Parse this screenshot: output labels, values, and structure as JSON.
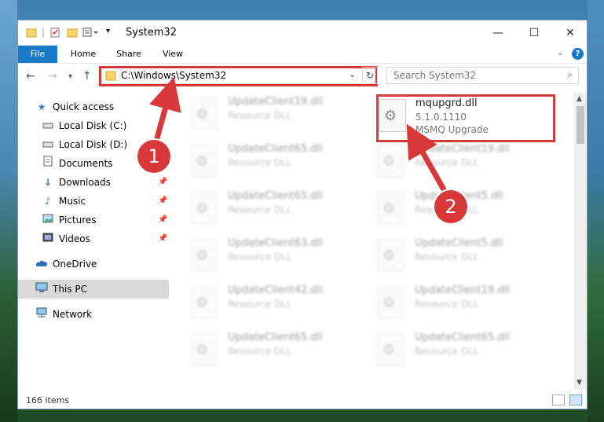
{
  "window": {
    "title": "System32"
  },
  "controls": {
    "minimize": "—",
    "maximize": "☐",
    "close": "✕"
  },
  "ribbon": {
    "tabs": [
      "File",
      "Home",
      "Share",
      "View"
    ],
    "help": "?"
  },
  "navigation": {
    "address": "C:\\Windows\\System32",
    "search_placeholder": "Search System32"
  },
  "sidebar": {
    "items": [
      {
        "label": "Quick access",
        "icon": "star-icon"
      },
      {
        "label": "Local Disk (C:)",
        "icon": "drive-icon"
      },
      {
        "label": "Local Disk (D:)",
        "icon": "drive-icon"
      },
      {
        "label": "Documents",
        "icon": "documents-icon"
      },
      {
        "label": "Downloads",
        "icon": "download-icon"
      },
      {
        "label": "Music",
        "icon": "music-icon"
      },
      {
        "label": "Pictures",
        "icon": "pictures-icon"
      },
      {
        "label": "Videos",
        "icon": "videos-icon"
      },
      {
        "label": "OneDrive",
        "icon": "cloud-icon"
      },
      {
        "label": "This PC",
        "icon": "computer-icon"
      },
      {
        "label": "Network",
        "icon": "network-icon"
      }
    ]
  },
  "files": {
    "highlighted": {
      "name": "mqupgrd.dll",
      "version": "5.1.0.1110",
      "description": "MSMQ Upgrade"
    },
    "left_column": [
      {
        "name": "UpdateClient19.dll",
        "type": "Resource DLL"
      },
      {
        "name": "UpdateClient65.dll",
        "type": "Resource DLL"
      },
      {
        "name": "UpdateClient65.dll",
        "type": "Resource DLL"
      },
      {
        "name": "UpdateClient63.dll",
        "type": "Resource DLL"
      },
      {
        "name": "UpdateClient42.dll",
        "type": "Resource DLL"
      },
      {
        "name": "UpdateClient65.dll",
        "type": "Resource DLL"
      }
    ],
    "right_column": [
      {
        "name": "UpdateClient19.dll",
        "type": "Resource DLL"
      },
      {
        "name": "UpdateClient5.dll",
        "type": "Resource DLL"
      },
      {
        "name": "UpdateClient5.dll",
        "type": "Resource DLL"
      },
      {
        "name": "UpdateClient19.dll",
        "type": "Resource DLL"
      },
      {
        "name": "UpdateClient65.dll",
        "type": "Resource DLL"
      }
    ]
  },
  "status": {
    "count": "166 items"
  },
  "annotations": {
    "step1": "1",
    "step2": "2"
  },
  "colors": {
    "accent": "#1979ca",
    "highlight": "#d9383a"
  }
}
